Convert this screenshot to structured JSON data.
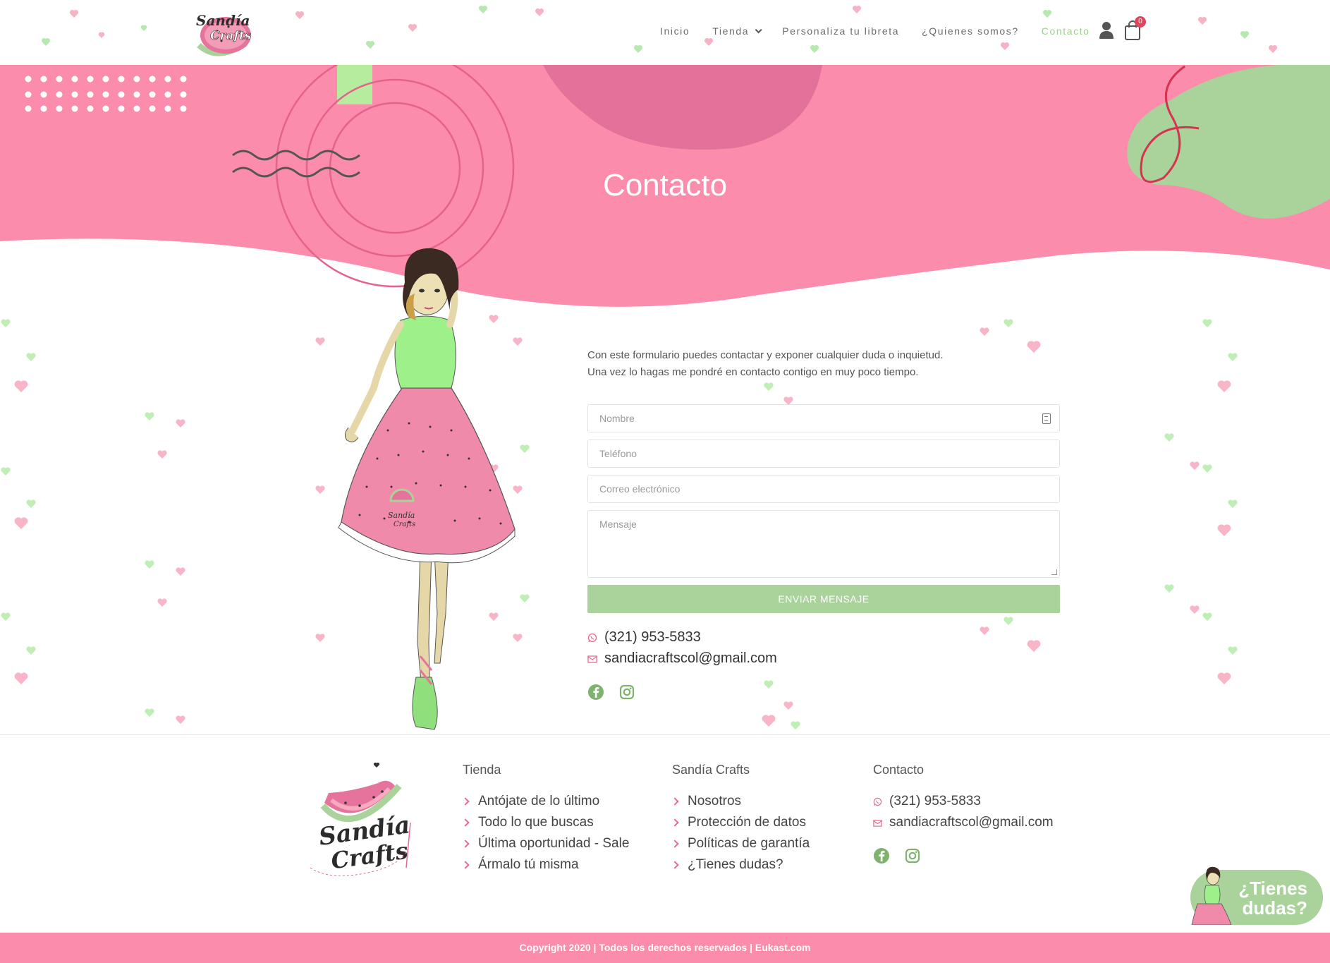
{
  "header": {
    "logo_text": "Sandía Crafts",
    "nav": [
      {
        "label": "Inicio",
        "active": false,
        "has_dropdown": false
      },
      {
        "label": "Tienda",
        "active": false,
        "has_dropdown": true
      },
      {
        "label": "Personaliza tu libreta",
        "active": false,
        "has_dropdown": false
      },
      {
        "label": "¿Quienes somos?",
        "active": false,
        "has_dropdown": false
      },
      {
        "label": "Contacto",
        "active": true,
        "has_dropdown": false
      }
    ],
    "cart_count": "0",
    "icons": [
      "user-icon",
      "cart-icon"
    ]
  },
  "hero": {
    "title": "Contacto"
  },
  "contact": {
    "intro_line1": "Con este formulario puedes contactar y exponer cualquier duda o inquietud.",
    "intro_line2": "Una vez lo hagas me pondré en contacto contigo en muy poco tiempo.",
    "form": {
      "name_placeholder": "Nombre",
      "phone_placeholder": "Teléfono",
      "email_placeholder": "Correo electrónico",
      "message_placeholder": "Mensaje",
      "submit_label": "ENVIAR MENSAJE"
    },
    "phone": "(321) 953-5833",
    "email": "sandiacraftscol@gmail.com",
    "social": [
      "facebook-icon",
      "instagram-icon"
    ]
  },
  "footer": {
    "logo_text": "Sandía Crafts",
    "col_tienda": {
      "title": "Tienda",
      "links": [
        "Antójate de lo último",
        "Todo lo que buscas",
        "Última oportunidad - Sale",
        "Ármalo tú misma"
      ]
    },
    "col_sandia": {
      "title": "Sandía Crafts",
      "links": [
        "Nosotros",
        "Protección de datos",
        "Políticas de garantía",
        "¿Tienes dudas?"
      ]
    },
    "col_contacto": {
      "title": "Contacto",
      "phone": "(321) 953-5833",
      "email": "sandiacraftscol@gmail.com"
    },
    "copyright": "Copyright 2020 | Todos los derechos reservados | Eukast.com"
  },
  "chat": {
    "line1": "¿Tienes",
    "line2": "dudas?"
  },
  "colors": {
    "pink": "#fb8cab",
    "dark_pink": "#e5739c",
    "green": "#a9d39b",
    "accent_red": "#e0455f"
  }
}
